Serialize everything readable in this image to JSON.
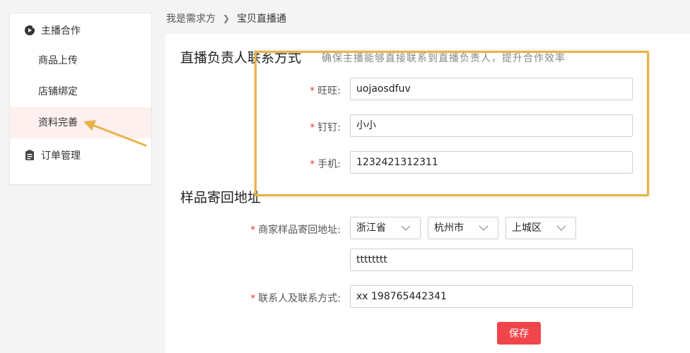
{
  "sidebar": {
    "group1": {
      "label": "主播合作",
      "icon": "play-circle-icon"
    },
    "items": [
      {
        "label": "商品上传"
      },
      {
        "label": "店铺绑定"
      },
      {
        "label": "资料完善",
        "active": true
      }
    ],
    "group2": {
      "label": "订单管理",
      "icon": "clipboard-icon"
    }
  },
  "breadcrumb": {
    "root": "我是需求方",
    "current": "宝贝直播通"
  },
  "contact_section": {
    "title": "直播负责人联系方式",
    "hint": "确保主播能够直接联系到直播负责人，提升合作效率",
    "fields": [
      {
        "label": "旺旺:",
        "value": "uojaosdfuv"
      },
      {
        "label": "钉钉:",
        "value": "小小"
      },
      {
        "label": "手机:",
        "value": "1232421312311"
      }
    ]
  },
  "sample_section": {
    "title": "样品寄回地址",
    "address_label": "商家样品寄回地址:",
    "province": "浙江省",
    "city": "杭州市",
    "district": "上城区",
    "detail_address": "tttttttt",
    "contact_label": "联系人及联系方式:",
    "contact_value": "xx 198765442341"
  },
  "save_label": "保存",
  "required_mark": "*",
  "colors": {
    "accent": "#f0464b",
    "annotation": "#e8b34b",
    "active_bg": "#fdf0ee"
  }
}
